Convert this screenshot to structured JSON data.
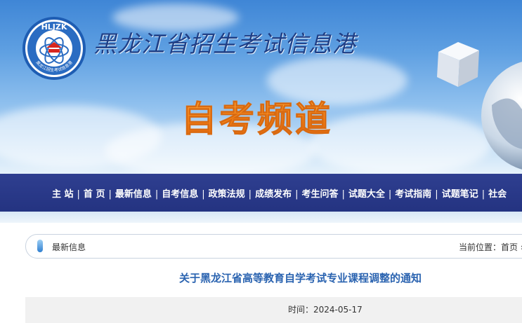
{
  "header": {
    "logo_text": "HLJZK",
    "logo_ring_text": "黑龙江招生考试信息港",
    "site_name": "黑龙江省招生考试信息港",
    "channel_title": "自考频道"
  },
  "nav": {
    "items": [
      "主 站",
      "首 页",
      "最新信息",
      "自考信息",
      "政策法规",
      "成绩发布",
      "考生问答",
      "试题大全",
      "考试指南",
      "试题笔记",
      "社会"
    ]
  },
  "breadcrumb": {
    "section": "最新信息",
    "location_prefix": "当前位置：",
    "location_home": "首页",
    "location_sep": " »"
  },
  "article": {
    "title": "关于黑龙江省高等教育自学考试专业课程调整的通知",
    "time_label": "时间：",
    "time_value": "2024-05-17"
  },
  "colors": {
    "nav_bg": "#2b3a8a",
    "title_blue": "#2a63b0",
    "channel_orange": "#ff8a17"
  }
}
